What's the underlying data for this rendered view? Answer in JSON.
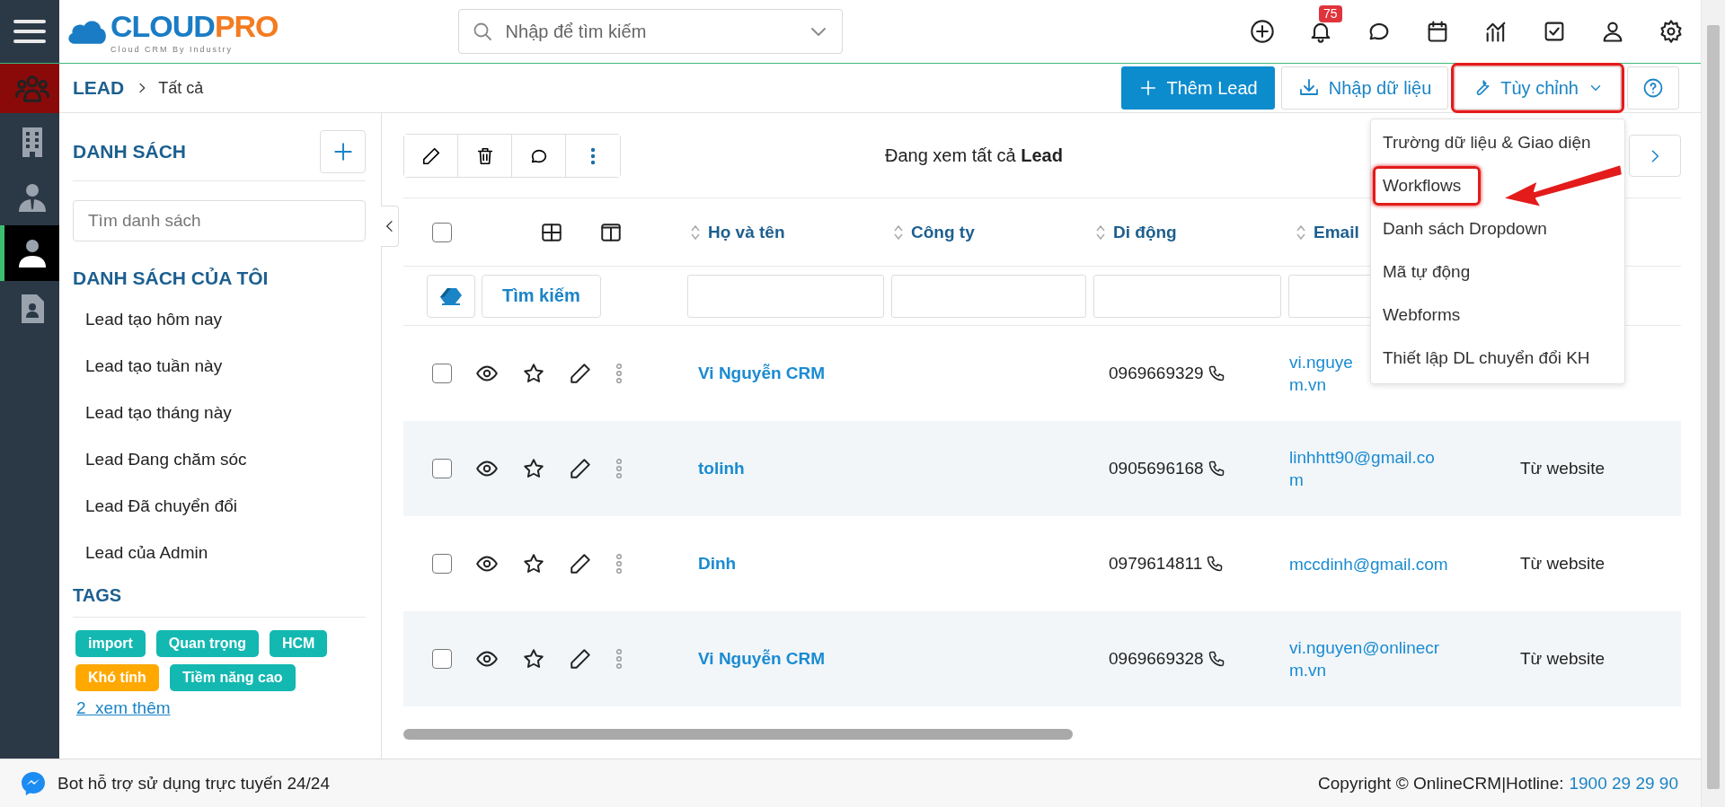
{
  "top_bar": {
    "logo": {
      "word_a": "CLOUD",
      "word_b": "PRO",
      "tagline": "Cloud CRM By Industry"
    },
    "search": {
      "placeholder": "Nhập để tìm kiếm"
    },
    "notification_count": "75"
  },
  "rail": {
    "items": [
      {
        "kind": "people-group",
        "selected": true,
        "highlighted": false
      },
      {
        "kind": "building",
        "selected": false,
        "highlighted": false
      },
      {
        "kind": "person-tie",
        "selected": false,
        "highlighted": false
      },
      {
        "kind": "person",
        "selected": false,
        "highlighted": true
      },
      {
        "kind": "contact-file",
        "selected": false,
        "highlighted": false
      }
    ]
  },
  "header": {
    "breadcrumb": {
      "module": "LEAD",
      "current": "Tất cả"
    },
    "actions": [
      {
        "kind": "add",
        "label": "Thêm Lead",
        "marked": false
      },
      {
        "kind": "import",
        "label": "Nhập dữ liệu",
        "marked": false
      },
      {
        "kind": "customize",
        "label": "Tùy chỉnh",
        "marked": true,
        "expanded": true
      },
      {
        "kind": "help",
        "marked": false
      }
    ],
    "menu": {
      "items": [
        {
          "label": "Trường dữ liệu & Giao diện",
          "marked": false
        },
        {
          "label": "Workflows",
          "marked": true
        },
        {
          "label": "Danh sách Dropdown",
          "marked": false
        },
        {
          "label": "Mã tự động",
          "marked": false
        },
        {
          "label": "Webforms",
          "marked": false
        },
        {
          "label": "Thiết lập DL chuyển đổi KH",
          "marked": false
        }
      ]
    }
  },
  "sidebar": {
    "title": "DANH SÁCH",
    "search_placeholder": "Tìm danh sách",
    "section": "DANH SÁCH CỦA TÔI",
    "items": [
      "Lead tạo hôm nay",
      "Lead tạo tuần này",
      "Lead tạo tháng này",
      "Lead Đang chăm sóc",
      "Lead Đã chuyển đổi",
      "Lead của Admin"
    ],
    "tags_title": "TAGS",
    "tags": [
      {
        "label": "import",
        "color": "#13b8b1"
      },
      {
        "label": "Quan trọng",
        "color": "#13b8b1"
      },
      {
        "label": "HCM",
        "color": "#13b8b1"
      },
      {
        "label": "Khó tính",
        "color": "#ffa800"
      },
      {
        "label": "Tiềm năng cao",
        "color": "#13b8b1"
      }
    ],
    "more_link": "2  xem thêm"
  },
  "table": {
    "viewing": "Đang xem tất cả **Lead**",
    "select_all_checked": false,
    "columns": [
      {
        "label": "Họ và tên"
      },
      {
        "label": "Công ty"
      },
      {
        "label": "Di động"
      },
      {
        "label": "Email"
      }
    ],
    "search_button": "Tìm kiếm",
    "rows": [
      {
        "checked": false,
        "starred": false,
        "name": "Vi Nguyễn CRM",
        "phone": "0969669329",
        "email": "vi.nguye\nm.vn"
      },
      {
        "checked": false,
        "starred": false,
        "name": "tolinh",
        "phone": "0905696168",
        "email": "linhhtt90@gmail.co\nm",
        "source": "Từ website"
      },
      {
        "checked": false,
        "starred": false,
        "name": "Dinh",
        "phone": "0979614811",
        "email": "mccdinh@gmail.com",
        "source": "Từ website"
      },
      {
        "checked": false,
        "starred": false,
        "name": "Vi Nguyễn CRM",
        "phone": "0969669328",
        "email": "vi.nguyen@onlinecr\nm.vn",
        "source": "Từ website"
      }
    ]
  },
  "footer": {
    "bot_text": "Bot hỗ trợ sử dụng trực tuyến 24/24",
    "copyright": "Copyright © OnlineCRM|Hotline:",
    "hotline": "1900 29 29 90"
  }
}
